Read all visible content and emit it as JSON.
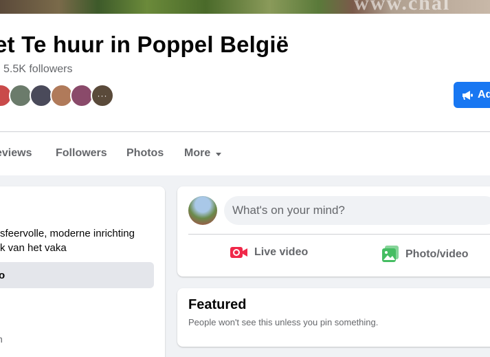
{
  "cover": {
    "watermark": "www.chal"
  },
  "page": {
    "title": "et Te huur in Poppel België",
    "followers": "5.5K followers",
    "avatars": [
      {
        "color": "#c94a4a"
      },
      {
        "color": "#6b7b6b"
      },
      {
        "color": "#4a4a5a"
      },
      {
        "color": "#b07a5a"
      },
      {
        "color": "#8a4a6a"
      },
      {
        "color": "#5a4a3a"
      }
    ],
    "avatars_more": "···",
    "ad_button_label": "Ad"
  },
  "tabs": {
    "reviews": "eviews",
    "followers": "Followers",
    "photos": "Photos",
    "more": "More"
  },
  "left": {
    "intro_line1": "sfeervolle, moderne inrichting",
    "intro_line2": "k van het vaka",
    "button_label": "o",
    "small_text": "n"
  },
  "composer": {
    "placeholder": "What's on your mind?",
    "live_video": "Live video",
    "photo_video": "Photo/video"
  },
  "featured": {
    "title": "Featured",
    "subtitle": "People won't see this unless you pin something."
  },
  "colors": {
    "accent": "#1877f2",
    "live_red": "#f02849",
    "photo_green": "#45bd62"
  }
}
